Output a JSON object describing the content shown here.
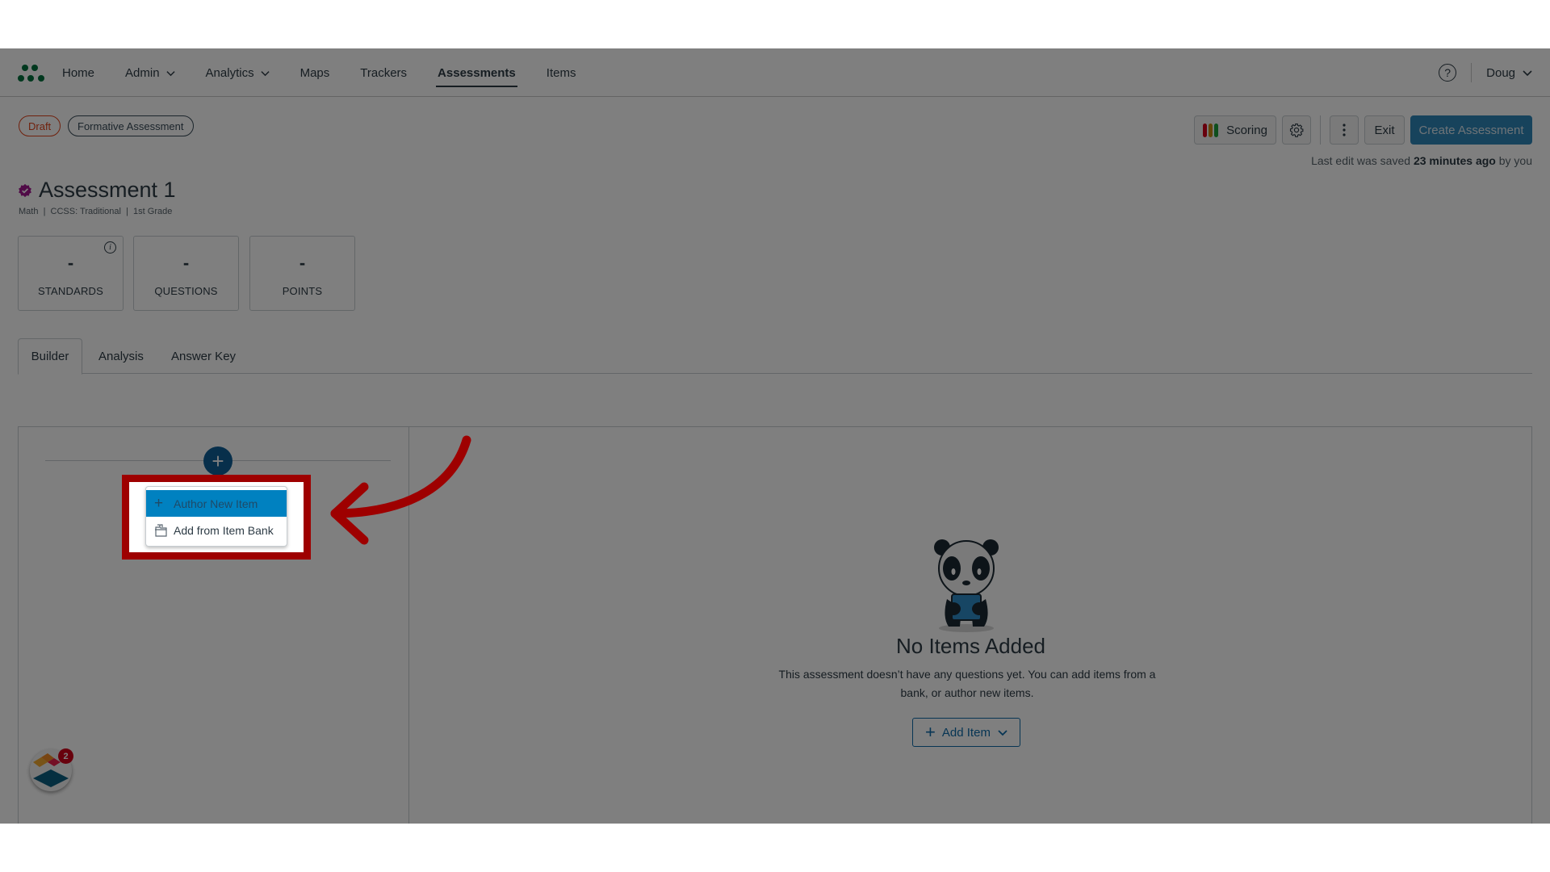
{
  "nav": {
    "items": [
      {
        "label": "Home",
        "dropdown": false,
        "active": false
      },
      {
        "label": "Admin",
        "dropdown": true,
        "active": false
      },
      {
        "label": "Analytics",
        "dropdown": true,
        "active": false
      },
      {
        "label": "Maps",
        "dropdown": false,
        "active": false
      },
      {
        "label": "Trackers",
        "dropdown": false,
        "active": false
      },
      {
        "label": "Assessments",
        "dropdown": false,
        "active": true
      },
      {
        "label": "Items",
        "dropdown": false,
        "active": false
      }
    ],
    "help_icon": "question-circle-icon",
    "user": "Doug"
  },
  "status_pills": {
    "draft": "Draft",
    "type": "Formative Assessment"
  },
  "toolbar": {
    "scoring_label": "Scoring",
    "scoring_colors": [
      "#d0021b",
      "#c78b12",
      "#1e9e3b"
    ],
    "gear_icon": "gear-icon",
    "more_icon": "kebab-menu-icon",
    "exit_label": "Exit",
    "create_label": "Create Assessment"
  },
  "save_status": {
    "prefix": "Last edit was saved ",
    "time": "23 minutes ago",
    "suffix": " by you"
  },
  "assessment": {
    "title": "Assessment 1",
    "meta": "Math  |  CCSS: Traditional  |  1st Grade",
    "verified_badge_color": "#a1178f"
  },
  "stats": [
    {
      "value": "-",
      "label": "STANDARDS",
      "info": true
    },
    {
      "value": "-",
      "label": "QUESTIONS",
      "info": false
    },
    {
      "value": "-",
      "label": "POINTS",
      "info": false
    }
  ],
  "tabs": [
    {
      "label": "Builder",
      "active": true
    },
    {
      "label": "Analysis",
      "active": false
    },
    {
      "label": "Answer Key",
      "active": false
    }
  ],
  "add_menu": {
    "items": [
      {
        "label": "Author New Item",
        "icon": "plus-icon",
        "selected": true
      },
      {
        "label": "Add from Item Bank",
        "icon": "item-bank-icon",
        "selected": false
      }
    ]
  },
  "empty_state": {
    "title": "No Items Added",
    "description": "This assessment doesn’t have any questions yet. You can add items from a bank, or author new items.",
    "button_label": "Add Item"
  },
  "help_widget": {
    "badge_count": "2"
  },
  "colors": {
    "highlight": "#9e0000",
    "primary": "#0e6ba8",
    "draft": "#e0431b",
    "logo": "#00703c"
  }
}
